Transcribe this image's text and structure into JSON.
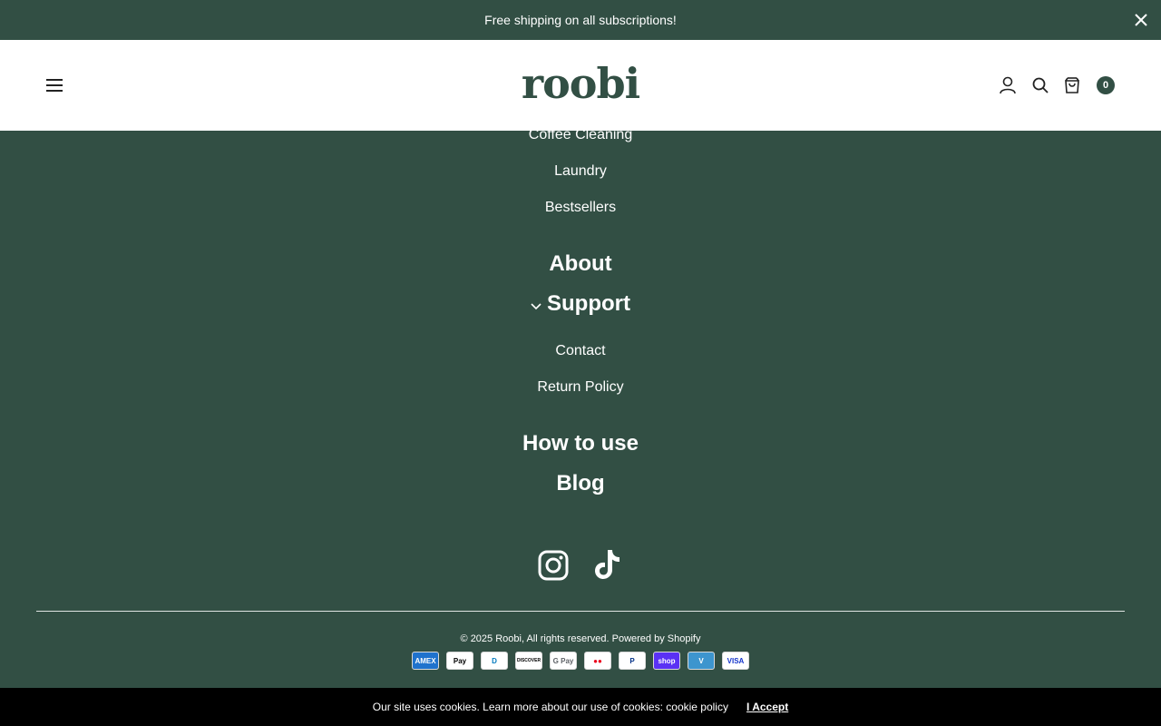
{
  "announcement": {
    "text": "Free shipping on all subscriptions!"
  },
  "header": {
    "logo": "roobi",
    "cart_count": "0"
  },
  "menu": {
    "sub_items_top": [
      "Coffee Cleaning",
      "Laundry",
      "Bestsellers"
    ],
    "about": "About",
    "support": "Support",
    "support_items": [
      "Contact",
      "Return Policy"
    ],
    "how_to_use": "How to use",
    "blog": "Blog"
  },
  "footer": {
    "copyright": "© 2025 Roobi, All rights reserved. Powered by Shopify",
    "payments": [
      {
        "name": "AMEX",
        "bg": "#1f72cd",
        "color": "#ffffff"
      },
      {
        "name": "Pay",
        "bg": "#ffffff",
        "color": "#000000"
      },
      {
        "name": "D",
        "bg": "#ffffff",
        "color": "#0079be"
      },
      {
        "name": "DISCOVER",
        "bg": "#ffffff",
        "color": "#000000"
      },
      {
        "name": "G Pay",
        "bg": "#ffffff",
        "color": "#5f6368"
      },
      {
        "name": "●●",
        "bg": "#ffffff",
        "color": "#eb001b"
      },
      {
        "name": "P",
        "bg": "#ffffff",
        "color": "#003087"
      },
      {
        "name": "shop",
        "bg": "#5a31f4",
        "color": "#ffffff"
      },
      {
        "name": "V",
        "bg": "#3d95ce",
        "color": "#ffffff"
      },
      {
        "name": "VISA",
        "bg": "#ffffff",
        "color": "#1434cb"
      }
    ]
  },
  "cookie": {
    "text": "Our site uses cookies. Learn more about our use of cookies: cookie policy",
    "accept": "I Accept"
  },
  "colors": {
    "brand_green": "#324f44",
    "white": "#ffffff",
    "cookie_bg": "#000000"
  }
}
